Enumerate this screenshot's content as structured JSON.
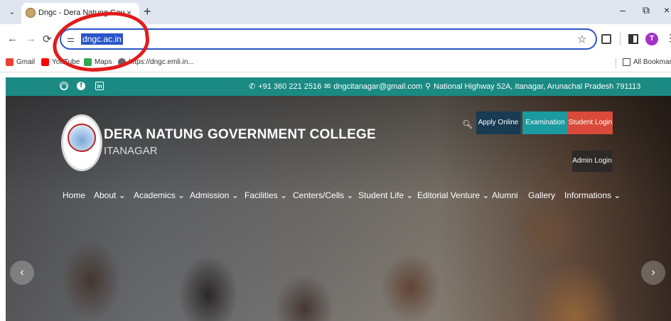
{
  "browser": {
    "tab_title": "Dngc - Dera Natung Government...",
    "tab_close": "×",
    "new_tab": "+",
    "menu_chevron": "⌄",
    "controls": {
      "minimize": "–",
      "restore": "⧉",
      "close": "×"
    },
    "nav": {
      "back": "←",
      "forward": "→",
      "reload": "⟳"
    },
    "site_info_icon": "⚌",
    "url": "dngc.ac.in",
    "star": "☆",
    "profile_initial": "T",
    "kebab": "⋮",
    "bookmarks": [
      {
        "label": "Gmail",
        "icon": "gmail-icon",
        "color": "#ea4335"
      },
      {
        "label": "YouTube",
        "icon": "youtube-icon",
        "color": "#ff0000"
      },
      {
        "label": "Maps",
        "icon": "maps-icon",
        "color": "#34a853"
      },
      {
        "label": "https://dngc.emli.in...",
        "icon": "globe-icon",
        "color": "#666666"
      }
    ],
    "all_bookmarks": "All Bookmarks",
    "annotation_color": "#e21b1b"
  },
  "site": {
    "topbar": {
      "social": [
        "whatsapp-icon",
        "facebook-icon",
        "linkedin-icon"
      ],
      "phone": "+91 360 221 2516",
      "email": "dngcitanagar@gmail.com",
      "address": "National Highway 52A, Itanagar, Arunachal Pradesh 791113",
      "color": "#1a8a83"
    },
    "header": {
      "college_name": "DERA NATUNG GOVERNMENT COLLEGE",
      "city": "ITANAGAR",
      "buttons": {
        "apply": "Apply Online",
        "exam": "Examination",
        "student": "Student Login",
        "admin": "Admin Login"
      }
    },
    "nav": [
      "Home",
      "About ⌄",
      "Academics ⌄",
      "Admission ⌄",
      "Facilities ⌄",
      "Centers/Cells ⌄",
      "Student Life ⌄",
      "Editorial Venture ⌄",
      "Alumni",
      "Gallery",
      "Informations ⌄"
    ],
    "carousel": {
      "prev": "‹",
      "next": "›"
    }
  }
}
